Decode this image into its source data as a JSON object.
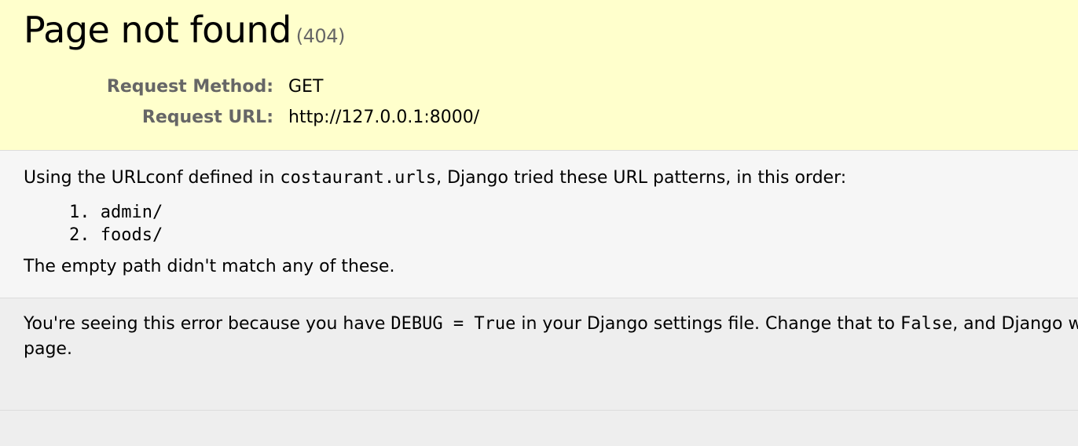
{
  "summary": {
    "title": "Page not found",
    "status": "(404)",
    "method_label": "Request Method:",
    "method_value": "GET",
    "url_label": "Request URL:",
    "url_value": "http://127.0.0.1:8000/"
  },
  "info": {
    "intro_before": "Using the URLconf defined in ",
    "intro_module": "costaurant.urls",
    "intro_after": ", Django tried these URL patterns, in this order:",
    "patterns": [
      {
        "number": "1.",
        "pattern": "admin/"
      },
      {
        "number": "2.",
        "pattern": "foods/"
      }
    ],
    "no_match": "The empty path didn't match any of these."
  },
  "explanation": {
    "part1": "You're seeing this error because you have ",
    "code1": "DEBUG = True",
    "part2": " in your Django settings file. Change that to ",
    "code2": "False",
    "part3": ", and Django w",
    "line2": "page."
  }
}
